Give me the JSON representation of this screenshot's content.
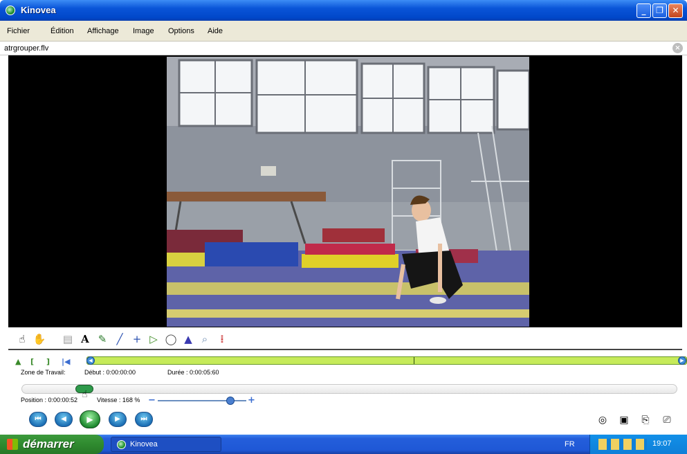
{
  "window": {
    "title": "Kinovea",
    "minimize_glyph": "_",
    "maximize_glyph": "❐",
    "close_glyph": "✕"
  },
  "menu": [
    "Fichier",
    "Édition",
    "Affichage",
    "Image",
    "Options",
    "Aide"
  ],
  "file_tab": {
    "name": "atrgrouper.flv",
    "close_glyph": "×"
  },
  "tools": [
    {
      "name": "pointer-tool-icon",
      "glyph": "☝"
    },
    {
      "name": "hand-tool-icon",
      "glyph": "✋"
    },
    {
      "name": "comment-tool-icon",
      "glyph": "▤"
    },
    {
      "name": "text-tool-icon",
      "glyph": "A"
    },
    {
      "name": "pencil-tool-icon",
      "glyph": "✎"
    },
    {
      "name": "line-tool-icon",
      "glyph": "╱"
    },
    {
      "name": "cross-tool-icon",
      "glyph": "+"
    },
    {
      "name": "angle-tool-icon",
      "glyph": "▷"
    },
    {
      "name": "chrono-tool-icon",
      "glyph": "◯"
    },
    {
      "name": "grid-tool-icon",
      "glyph": "▲"
    },
    {
      "name": "magnifier-tool-icon",
      "glyph": "⌕"
    },
    {
      "name": "color-profile-icon",
      "glyph": "⁞"
    }
  ],
  "working_zone": {
    "label": "Zone de Travail:",
    "debut": "Début : 0:00:00:00",
    "duree": "Durée : 0:00:05:60"
  },
  "position": {
    "label": "Position : 0:00:00:52",
    "fraction": 0.1
  },
  "speed": {
    "label": "Vitesse : 168 %",
    "minus": "−",
    "plus": "+"
  },
  "playback_glyphs": {
    "first": "⏮",
    "prev": "◀",
    "play": "▶",
    "next": "▶",
    "last": "⏭"
  },
  "right_icons": [
    {
      "name": "sync-icon",
      "glyph": "◎"
    },
    {
      "name": "snapshot-icon",
      "glyph": "▣"
    },
    {
      "name": "export-icon",
      "glyph": "⎘"
    },
    {
      "name": "presentation-icon",
      "glyph": "⎚"
    }
  ],
  "taskbar": {
    "start_label": "démarrer",
    "task_label": "Kinovea",
    "language": "FR",
    "clock": "19:07"
  }
}
